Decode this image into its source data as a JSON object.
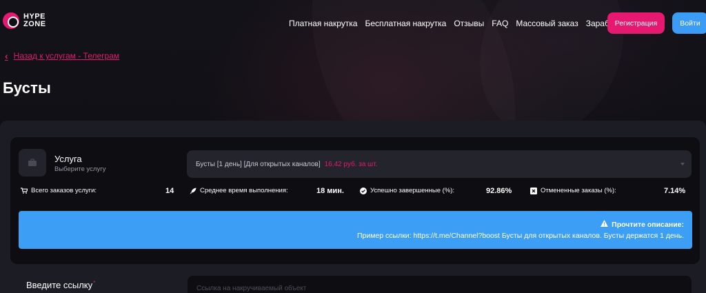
{
  "header": {
    "logo_line1": "HYPE",
    "logo_line2": "ZONE",
    "nav": [
      {
        "label": "Платная накрутка"
      },
      {
        "label": "Бесплатная накрутка"
      },
      {
        "label": "Отзывы"
      },
      {
        "label": "FAQ"
      },
      {
        "label": "Массовый заказ"
      },
      {
        "label": "Заработок"
      }
    ],
    "register_label": "Регистрация",
    "login_label": "Войти"
  },
  "breadcrumb": {
    "back_label": "Назад к услугам - Телеграм"
  },
  "page": {
    "title": "Бусты"
  },
  "service": {
    "title": "Услуга",
    "subtitle": "Выберите услугу",
    "icon": "briefcase-icon",
    "selected_name": "Бусты [1 день] [Для открытых каналов]",
    "selected_price": "16.42 руб. за шт."
  },
  "stats": [
    {
      "icon": "cart-icon",
      "label": "Всего заказов услуги:",
      "value": "14"
    },
    {
      "icon": "rocket-icon",
      "label": "Среднее время выполнения:",
      "value": "18 мин."
    },
    {
      "icon": "check-circle-icon",
      "label": "Успешно завершенные (%):",
      "value": "92.86%"
    },
    {
      "icon": "x-square-icon",
      "label": "Отмененные заказы (%):",
      "value": "7.14%"
    }
  ],
  "info": {
    "heading": "Прочтите описание:",
    "text": "Пример ссылки: https://t.me/Channel?boost Бусты для открытых каналов. Бусты держатся 1 день."
  },
  "link": {
    "label": "Введите ссылку",
    "required_mark": "*",
    "placeholder": "Ссылка на накручиваемый объект"
  },
  "colors": {
    "accent": "#e5196f",
    "primary": "#3b9bf5",
    "info_bg": "#3d9ef6",
    "card_bg": "#0d0d12"
  }
}
